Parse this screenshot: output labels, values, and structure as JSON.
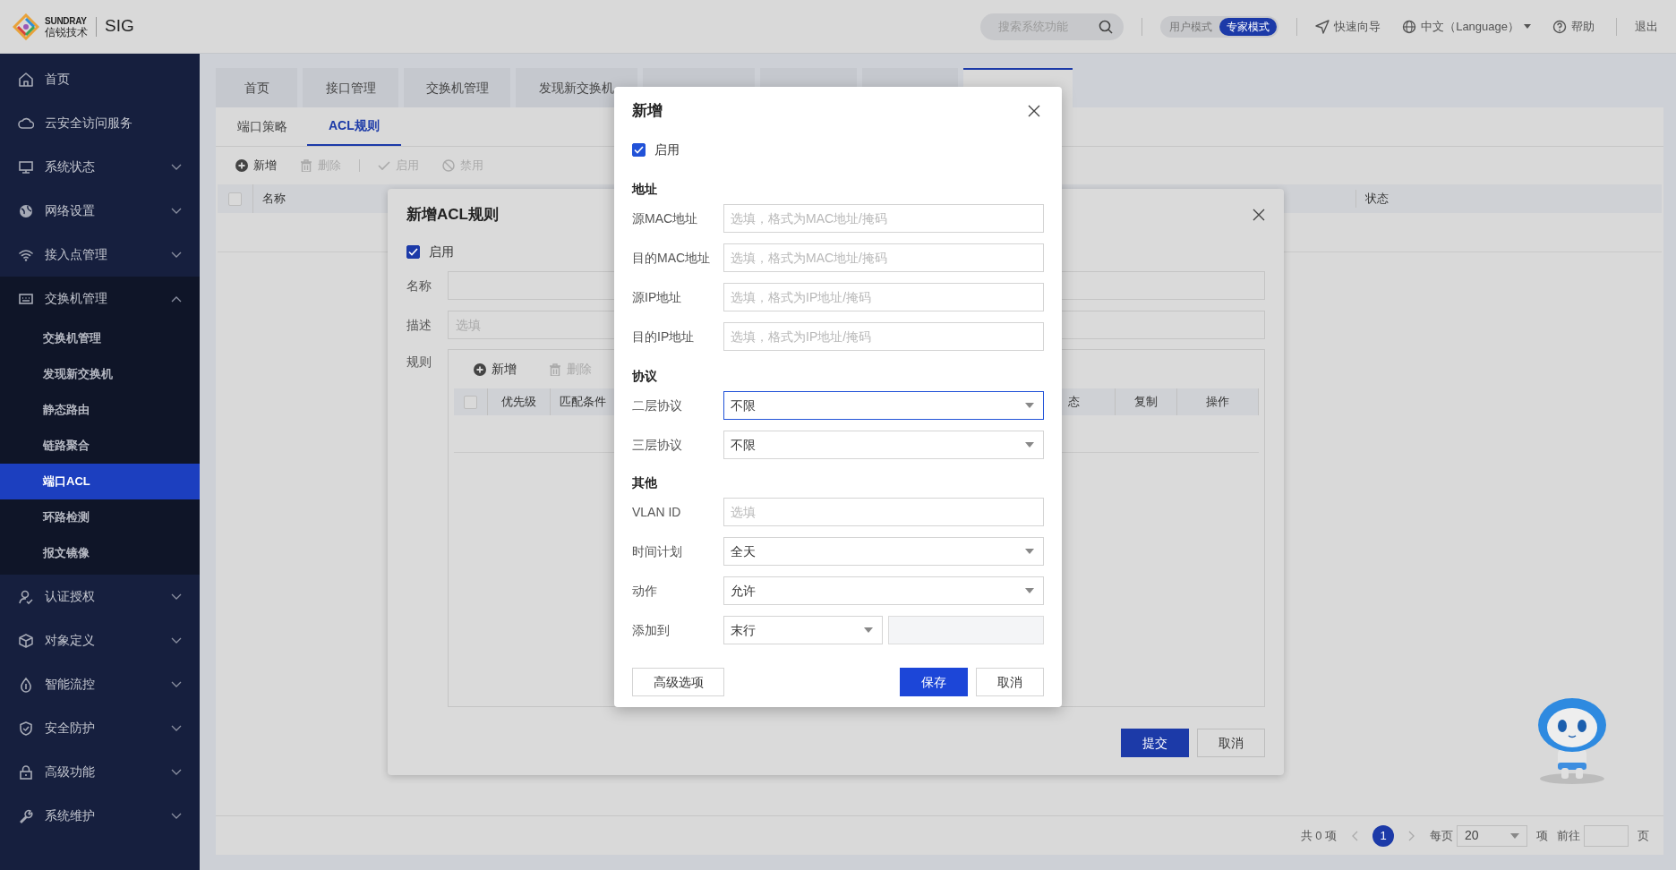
{
  "header": {
    "brand_top": "SUNDRAY",
    "brand_bottom": "信锐技术",
    "product": "SIG",
    "search": {
      "placeholder": "搜索系统功能"
    },
    "modes": [
      {
        "label": "用户模式",
        "selected": false
      },
      {
        "label": "专家模式",
        "selected": true
      }
    ],
    "links": [
      {
        "kind": "guide",
        "label": "快速向导"
      },
      {
        "kind": "language",
        "label": "中文（Language）"
      },
      {
        "kind": "help",
        "label": "帮助"
      },
      {
        "kind": "logout",
        "label": "退出"
      }
    ]
  },
  "sidebar": {
    "items": [
      {
        "kind": "link",
        "label": "首页"
      },
      {
        "kind": "link",
        "label": "云安全访问服务"
      },
      {
        "kind": "group",
        "label": "系统状态",
        "expanded": false
      },
      {
        "kind": "group",
        "label": "网络设置",
        "expanded": false
      },
      {
        "kind": "group",
        "label": "接入点管理",
        "expanded": false
      },
      {
        "kind": "group",
        "label": "交换机管理",
        "expanded": true,
        "children": [
          {
            "label": "交换机管理",
            "selected": false
          },
          {
            "label": "发现新交换机",
            "selected": false
          },
          {
            "label": "静态路由",
            "selected": false
          },
          {
            "label": "链路聚合",
            "selected": false
          },
          {
            "label": "端口ACL",
            "selected": true
          },
          {
            "label": "环路检测",
            "selected": false
          },
          {
            "label": "报文镜像",
            "selected": false
          }
        ]
      },
      {
        "kind": "group",
        "label": "认证授权",
        "expanded": false
      },
      {
        "kind": "group",
        "label": "对象定义",
        "expanded": false
      },
      {
        "kind": "group",
        "label": "智能流控",
        "expanded": false
      },
      {
        "kind": "group",
        "label": "安全防护",
        "expanded": false
      },
      {
        "kind": "group",
        "label": "高级功能",
        "expanded": false
      },
      {
        "kind": "group",
        "label": "系统维护",
        "expanded": false
      }
    ]
  },
  "tabs": [
    {
      "label": "首页",
      "selected": false
    },
    {
      "label": "接口管理",
      "selected": false
    },
    {
      "label": "交换机管理",
      "selected": false
    },
    {
      "label": "发现新交换机",
      "selected": false
    },
    {
      "selected": false
    },
    {
      "selected": false
    },
    {
      "selected": false
    },
    {
      "selected": true
    }
  ],
  "sub_tabs": [
    {
      "label": "端口策略",
      "selected": false
    },
    {
      "label": "ACL规则",
      "selected": true
    }
  ],
  "toolbar": [
    {
      "kind": "add",
      "label": "新增",
      "disabled": false
    },
    {
      "kind": "delete",
      "label": "删除",
      "disabled": true
    },
    {
      "kind": "enable",
      "label": "启用",
      "disabled": true
    },
    {
      "kind": "disable",
      "label": "禁用",
      "disabled": true
    }
  ],
  "table": {
    "select_all": {
      "checked": false
    },
    "columns": [
      "名称",
      "状态"
    ]
  },
  "pagination": {
    "total": "共 0 项",
    "pages": [
      {
        "label": "1",
        "selected": true
      }
    ],
    "per_page_label": "每页",
    "page_size": "20",
    "per_page_unit": "项",
    "goto_label": "前往",
    "goto_unit": "页"
  },
  "acl_dialog": {
    "title": "新增ACL规则",
    "enabled": {
      "label": "启用",
      "checked": true
    },
    "fields": [
      {
        "label": "名称"
      },
      {
        "label": "描述",
        "placeholder": "选填"
      }
    ],
    "rules_label": "规则",
    "rules_toolbar": [
      {
        "kind": "add",
        "label": "新增",
        "disabled": false
      },
      {
        "kind": "delete",
        "label": "删除",
        "disabled": true
      }
    ],
    "rules_select_all": {
      "checked": false
    },
    "rules_columns": [
      "优先级",
      "匹配条件",
      "态",
      "复制",
      "操作"
    ],
    "buttons": [
      {
        "kind": "primary",
        "label": "提交"
      },
      {
        "kind": "default",
        "label": "取消"
      }
    ]
  },
  "add_dialog": {
    "title": "新增",
    "enabled": {
      "label": "启用",
      "checked": true
    },
    "sections": [
      {
        "heading": "地址",
        "fields": [
          {
            "kind": "text",
            "label": "源MAC地址",
            "placeholder": "选填，格式为MAC地址/掩码",
            "focused": false
          },
          {
            "kind": "text",
            "label": "目的MAC地址",
            "placeholder": "选填，格式为MAC地址/掩码",
            "focused": false
          },
          {
            "kind": "text",
            "label": "源IP地址",
            "placeholder": "选填，格式为IP地址/掩码",
            "focused": false
          },
          {
            "kind": "text",
            "label": "目的IP地址",
            "placeholder": "选填，格式为IP地址/掩码",
            "focused": false
          }
        ]
      },
      {
        "heading": "协议",
        "fields": [
          {
            "kind": "select",
            "label": "二层协议",
            "value": "不限",
            "focused": true
          },
          {
            "kind": "select",
            "label": "三层协议",
            "value": "不限",
            "focused": false
          }
        ]
      },
      {
        "heading": "其他",
        "fields": [
          {
            "kind": "text",
            "label": "VLAN ID",
            "placeholder": "选填",
            "focused": false
          },
          {
            "kind": "select",
            "label": "时间计划",
            "value": "全天",
            "focused": false
          },
          {
            "kind": "select",
            "label": "动作",
            "value": "允许",
            "focused": false
          },
          {
            "kind": "select_pair",
            "label": "添加到",
            "value": "末行",
            "focused": false
          }
        ]
      }
    ],
    "buttons": [
      {
        "kind": "default",
        "label": "高级选项"
      },
      {
        "kind": "primary",
        "label": "保存"
      },
      {
        "kind": "default",
        "label": "取消"
      }
    ]
  }
}
